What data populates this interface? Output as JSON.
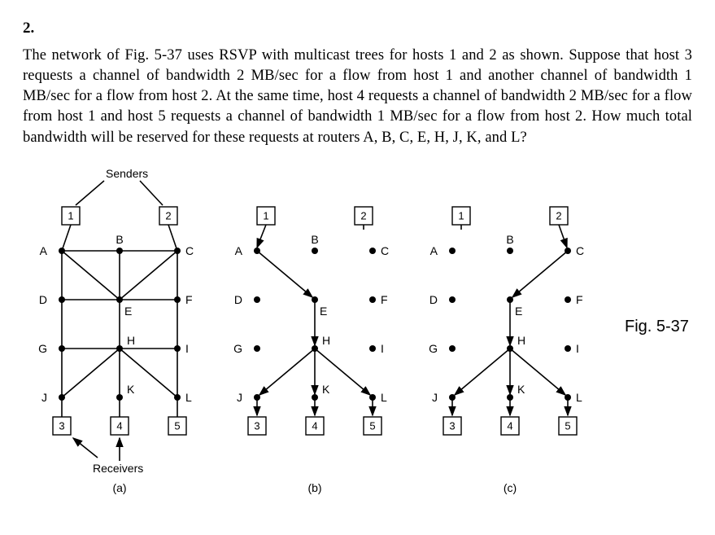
{
  "question_number": "2.",
  "paragraph": "The network of Fig. 5-37 uses RSVP with multicast trees for hosts 1 and 2 as shown. Suppose that host 3 requests a channel of bandwidth 2 MB/sec for a flow from host 1 and another channel of bandwidth 1 MB/sec for a flow from host 2.  At the same time, host 4 requests a channel of bandwidth 2 MB/sec for a flow from host 1 and host 5 requests a channel of bandwidth 1 MB/sec for a flow from host 2.  How much total bandwidth will be reserved for these requests at routers A, B, C, E, H, J, K, and L?",
  "figure_label": "Fig. 5-37",
  "annotations": {
    "senders": "Senders",
    "receivers": "Receivers"
  },
  "captions": {
    "a": "(a)",
    "b": "(b)",
    "c": "(c)"
  },
  "hosts": {
    "h1": "1",
    "h2": "2",
    "h3": "3",
    "h4": "4",
    "h5": "5"
  },
  "routers": {
    "A": "A",
    "B": "B",
    "C": "C",
    "D": "D",
    "E": "E",
    "F": "F",
    "G": "G",
    "H": "H",
    "I": "I",
    "J": "J",
    "K": "K",
    "L": "L"
  },
  "chart_data": [
    {
      "type": "diagram",
      "title": "(a) Full network topology",
      "senders": [
        "1",
        "2"
      ],
      "receivers": [
        "3",
        "4",
        "5"
      ],
      "routers": [
        "A",
        "B",
        "C",
        "D",
        "E",
        "F",
        "G",
        "H",
        "I",
        "J",
        "K",
        "L"
      ],
      "edges": [
        [
          "1",
          "A"
        ],
        [
          "2",
          "C"
        ],
        [
          "A",
          "B"
        ],
        [
          "B",
          "C"
        ],
        [
          "A",
          "D"
        ],
        [
          "A",
          "E"
        ],
        [
          "B",
          "E"
        ],
        [
          "C",
          "E"
        ],
        [
          "C",
          "F"
        ],
        [
          "D",
          "E"
        ],
        [
          "E",
          "F"
        ],
        [
          "D",
          "G"
        ],
        [
          "E",
          "H"
        ],
        [
          "F",
          "I"
        ],
        [
          "G",
          "H"
        ],
        [
          "H",
          "I"
        ],
        [
          "G",
          "J"
        ],
        [
          "H",
          "J"
        ],
        [
          "H",
          "K"
        ],
        [
          "H",
          "L"
        ],
        [
          "I",
          "L"
        ],
        [
          "J",
          "3"
        ],
        [
          "K",
          "4"
        ],
        [
          "L",
          "5"
        ]
      ]
    },
    {
      "type": "diagram",
      "title": "(b) Multicast tree for host 1",
      "edges": [
        [
          "1",
          "A"
        ],
        [
          "A",
          "E"
        ],
        [
          "E",
          "H"
        ],
        [
          "H",
          "J"
        ],
        [
          "H",
          "K"
        ],
        [
          "H",
          "L"
        ],
        [
          "J",
          "3"
        ],
        [
          "K",
          "4"
        ],
        [
          "L",
          "5"
        ]
      ]
    },
    {
      "type": "diagram",
      "title": "(c) Multicast tree for host 2",
      "edges": [
        [
          "2",
          "C"
        ],
        [
          "C",
          "E"
        ],
        [
          "E",
          "H"
        ],
        [
          "H",
          "J"
        ],
        [
          "H",
          "K"
        ],
        [
          "H",
          "L"
        ],
        [
          "J",
          "3"
        ],
        [
          "K",
          "4"
        ],
        [
          "L",
          "5"
        ]
      ]
    }
  ]
}
